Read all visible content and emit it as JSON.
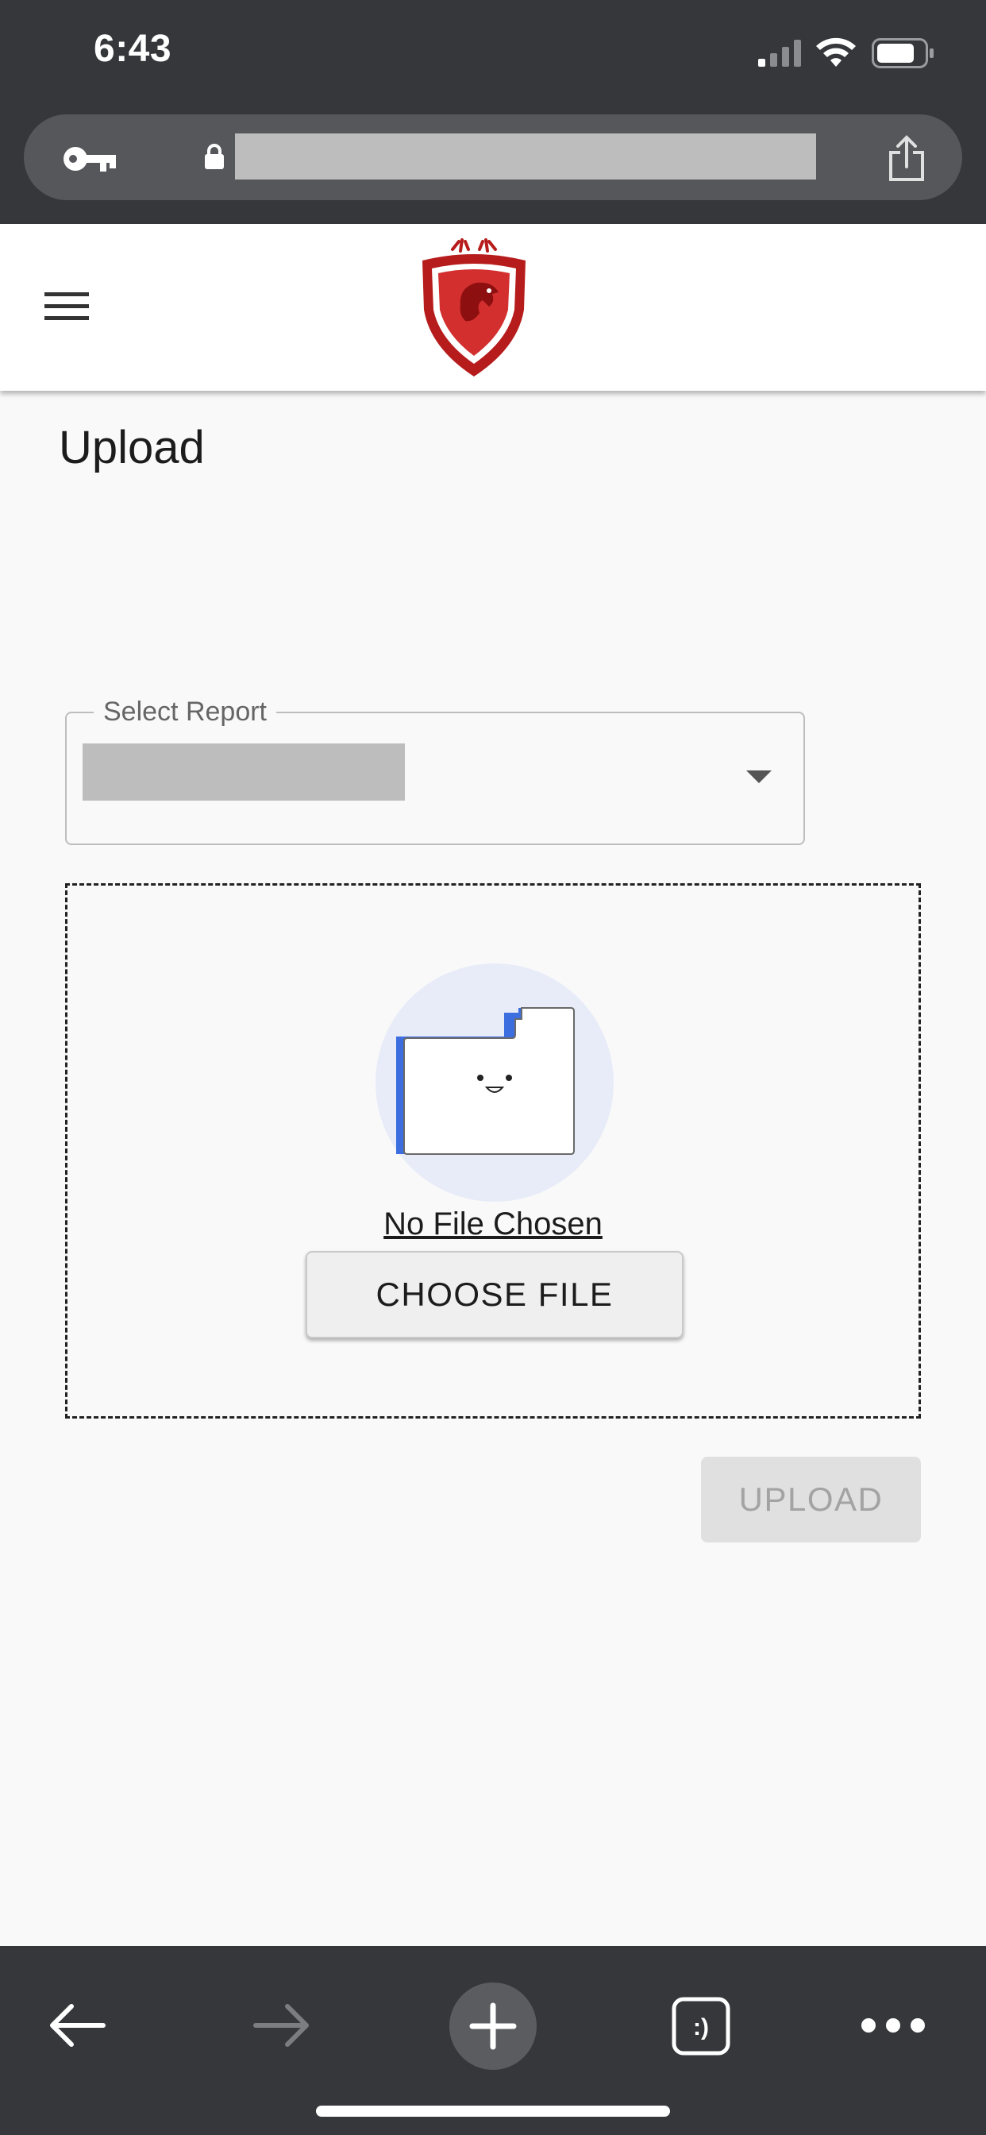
{
  "status_bar": {
    "time": "6:43",
    "icons": [
      "cellular-signal-icon",
      "wifi-icon",
      "battery-icon"
    ]
  },
  "browser": {
    "url": "",
    "icons": [
      "key-icon",
      "lock-icon",
      "share-icon"
    ]
  },
  "header": {
    "menu_icon": "hamburger-menu-icon",
    "logo": "eagle-shield-logo"
  },
  "page": {
    "title": "Upload"
  },
  "select_report": {
    "label": "Select Report",
    "value": ""
  },
  "dropzone": {
    "illustration": "smiling-folder-illustration",
    "status": "No File Chosen",
    "choose_label": "CHOOSE FILE"
  },
  "upload": {
    "label": "UPLOAD",
    "enabled": false
  },
  "bottom_toolbar": {
    "icons": [
      "back-arrow-icon",
      "forward-arrow-icon",
      "plus-icon",
      "tabs-icon",
      "more-icon"
    ],
    "tabs_label": ":)"
  },
  "colors": {
    "browser_chrome": "#35373b",
    "url_pill": "#55575b",
    "page_background": "#f9f9f9",
    "logo_red": "#c62828",
    "folder_blue": "#3d6ee0",
    "illustration_bg": "#e8ecf8",
    "disabled_button": "#e0e0e0"
  }
}
